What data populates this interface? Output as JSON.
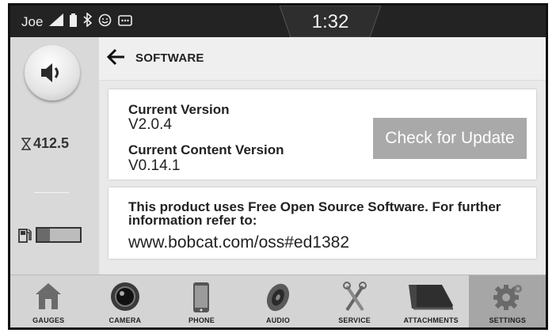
{
  "status": {
    "user": "Joe",
    "time": "1:32",
    "icons": [
      "signal-icon",
      "battery-icon",
      "bluetooth-icon",
      "smiley-icon",
      "message-icon"
    ]
  },
  "rail": {
    "hours_value": "412.5",
    "fuel_level_fraction": 0.3
  },
  "header": {
    "title": "SOFTWARE"
  },
  "version": {
    "current_label": "Current Version",
    "current_value": "V2.0.4",
    "content_label": "Current Content Version",
    "content_value": "V0.14.1",
    "update_button": "Check for Update"
  },
  "oss": {
    "text": "This product uses Free Open Source Software. For further information refer to:",
    "link": "www.bobcat.com/oss#ed1382"
  },
  "nav": {
    "items": [
      {
        "label": "GAUGES",
        "icon": "house-icon",
        "active": false
      },
      {
        "label": "CAMERA",
        "icon": "camera-lens-icon",
        "active": false
      },
      {
        "label": "PHONE",
        "icon": "phone-icon",
        "active": false
      },
      {
        "label": "AUDIO",
        "icon": "speaker-icon",
        "active": false
      },
      {
        "label": "SERVICE",
        "icon": "tools-icon",
        "active": false
      },
      {
        "label": "ATTACHMENTS",
        "icon": "bucket-icon",
        "active": false
      },
      {
        "label": "SETTINGS",
        "icon": "gear-icon",
        "active": true
      }
    ]
  },
  "colors": {
    "status_bar": "#232323",
    "background": "#e9e9e9",
    "button_disabled": "#a9a9a9",
    "active_tab": "#a6a6a6"
  }
}
